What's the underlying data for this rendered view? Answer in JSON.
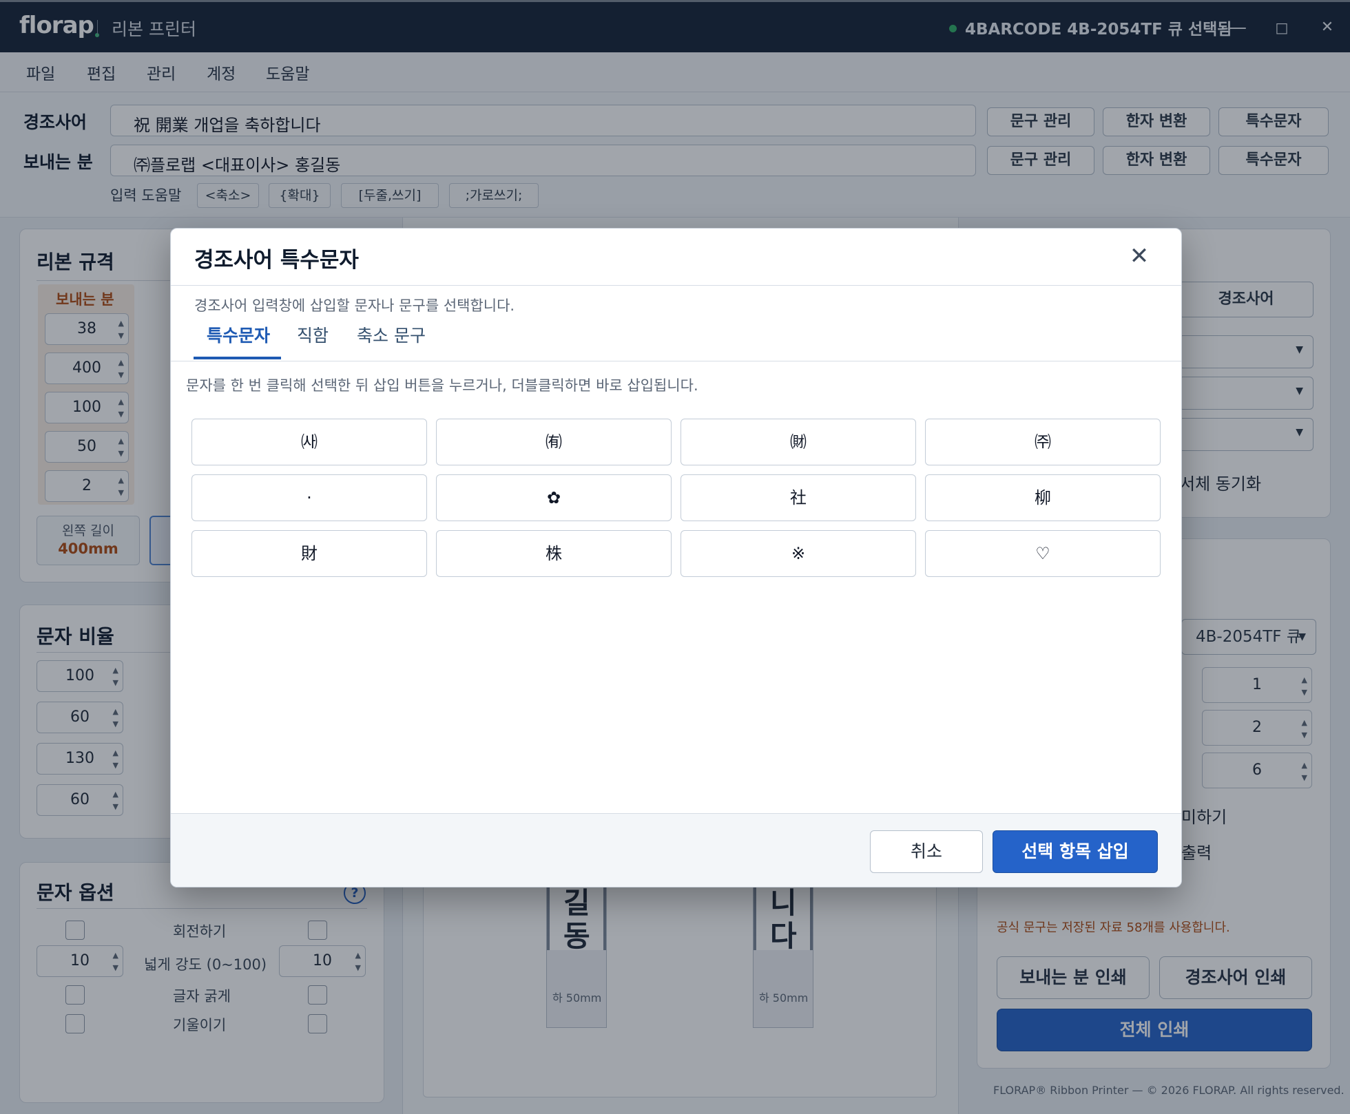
{
  "app": {
    "logo": "florap",
    "name": "리본 프린터",
    "status": "4BARCODE 4B-2054TF 큐 선택됨",
    "window_controls": {
      "minimize": "—",
      "maximize": "□",
      "close": "✕"
    }
  },
  "menu": [
    "파일",
    "편집",
    "관리",
    "계정",
    "도움말"
  ],
  "inputs": {
    "greeting": {
      "label": "경조사어",
      "value": "祝 開業 개업을 축하합니다"
    },
    "sender": {
      "label": "보내는 분",
      "value": "㈜플로랩 <대표이사> 홍길동"
    },
    "buttons": [
      "문구 관리",
      "한자 변환",
      "특수문자"
    ],
    "help_label": "입력 도움말",
    "help_chips": [
      "<축소>",
      "{확대}",
      "[두줄,쓰기]",
      ";가로쓰기;"
    ]
  },
  "ribbon_spec": {
    "title": "리본 규격",
    "column_label": "보내는 분",
    "values": [
      "38",
      "400",
      "100",
      "50",
      "2"
    ],
    "left_length_label": "왼쪽 길이",
    "left_length_value": "400mm"
  },
  "char_ratio": {
    "title": "문자 비율",
    "values": [
      "100",
      "60",
      "130",
      "60"
    ]
  },
  "char_options": {
    "title": "문자 옵션",
    "help_icon": "?",
    "rotate": "회전하기",
    "spread": "넓게 강도 (0~100)",
    "spread_left": "10",
    "spread_right": "10",
    "bold": "글자 굵게",
    "italic": "기울이기"
  },
  "preview": {
    "left_chars": [
      "길",
      "동"
    ],
    "right_chars": [
      "니",
      "다"
    ],
    "left_bottom": "하 50mm",
    "right_bottom": "하 50mm"
  },
  "right_panel": {
    "greeting_button": "경조사어",
    "sync_label": "서체 동기화",
    "printer_value": "4B-2054TF 큐",
    "spin_values": [
      "1",
      "2",
      "6"
    ],
    "option1": "미하기",
    "option2": "출력",
    "info_text": "공식 문구는 저장된 자료 58개를 사용합니다.",
    "print_sender": "보내는 분 인쇄",
    "print_greeting": "경조사어 인쇄",
    "print_all": "전체 인쇄",
    "footer": "FLORAP® Ribbon Printer — © 2026 FLORAP. All rights reserved."
  },
  "modal": {
    "title": "경조사어 특수문자",
    "close": "✕",
    "subtitle": "경조사어 입력창에 삽입할 문자나 문구를 선택합니다.",
    "tabs": [
      "특수문자",
      "직함",
      "축소 문구"
    ],
    "active_tab": 0,
    "instruction": "문자를 한 번 클릭해 선택한 뒤 삽입 버튼을 누르거나, 더블클릭하면 바로 삽입됩니다.",
    "characters": [
      "㈔",
      "㈲",
      "㈶",
      "㈜",
      "·",
      "✿",
      "社",
      "柳",
      "財",
      "株",
      "※",
      "♡"
    ],
    "cancel": "취소",
    "insert": "선택 항목 삽입"
  },
  "colors": {
    "titlebar": "#152236",
    "accent": "#2563c9",
    "status_led": "#2fae67",
    "warning_text": "#b04a12"
  }
}
